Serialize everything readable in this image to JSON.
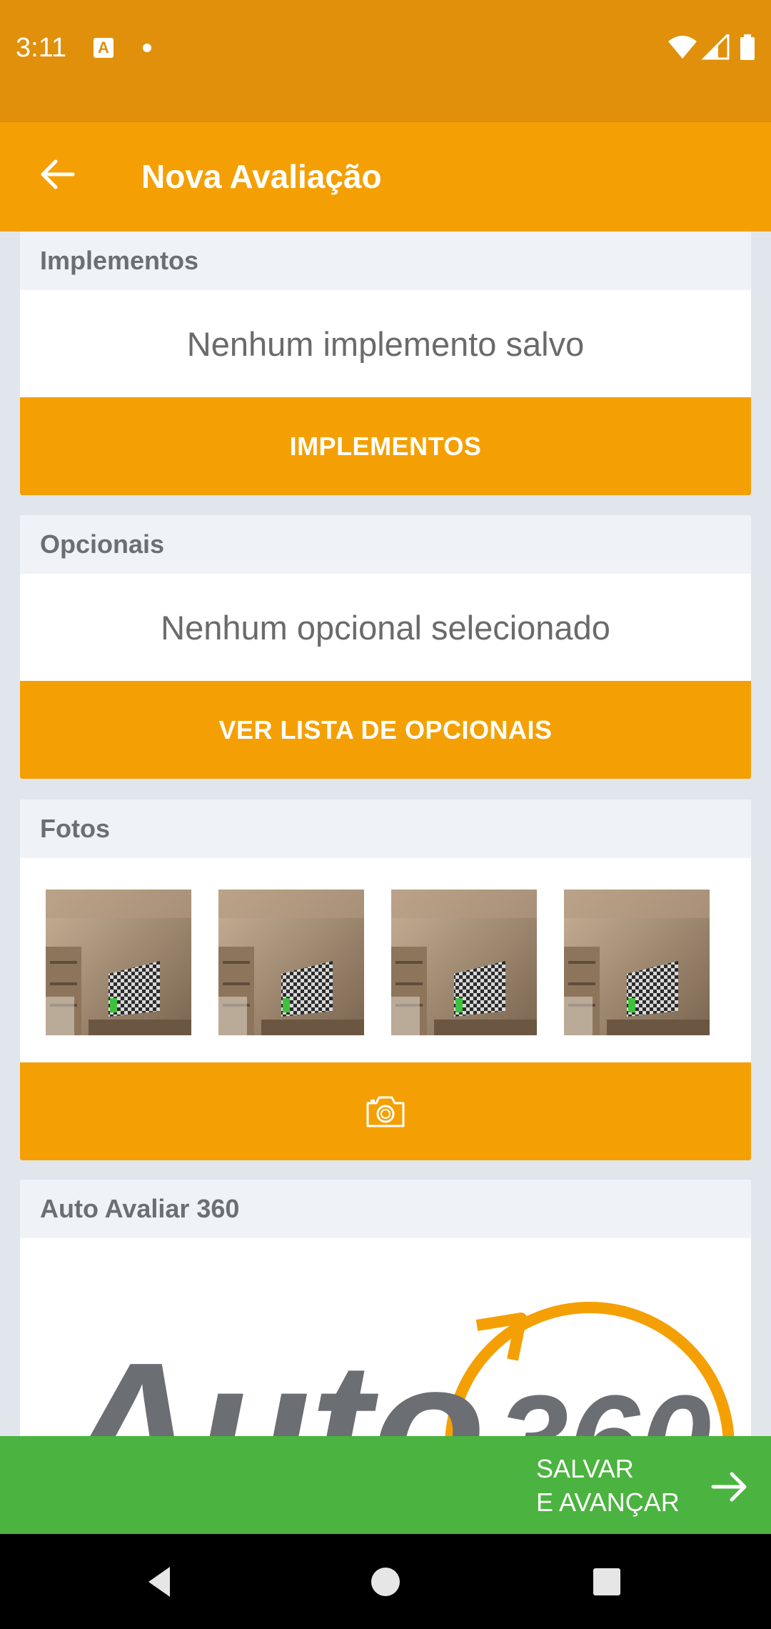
{
  "status_bar": {
    "time": "3:11",
    "notification_icon_letter": "A",
    "icons": [
      "wifi-icon",
      "cell-signal-icon",
      "battery-icon"
    ]
  },
  "app_bar": {
    "title": "Nova Avaliação",
    "back_icon": "arrow-left-icon"
  },
  "sections": {
    "implementos": {
      "header": "Implementos",
      "empty_text": "Nenhum implemento salvo",
      "button_label": "IMPLEMENTOS"
    },
    "opcionais": {
      "header": "Opcionais",
      "empty_text": "Nenhum opcional selecionado",
      "button_label": "VER LISTA DE OPCIONAIS"
    },
    "fotos": {
      "header": "Fotos",
      "photo_count": 4,
      "button_icon": "camera-icon"
    },
    "auto_avaliar": {
      "header": "Auto Avaliar 360",
      "logo_text": "Auto",
      "logo_number": "360"
    }
  },
  "footer": {
    "save_line1": "SALVAR",
    "save_line2": "E AVANÇAR",
    "save_icon": "arrow-right-icon"
  },
  "colors": {
    "status_bar": "#e0900a",
    "primary": "#f4a004",
    "save_green": "#4bb33f",
    "background": "#e1e6ec",
    "card_header": "#eff2f6"
  }
}
